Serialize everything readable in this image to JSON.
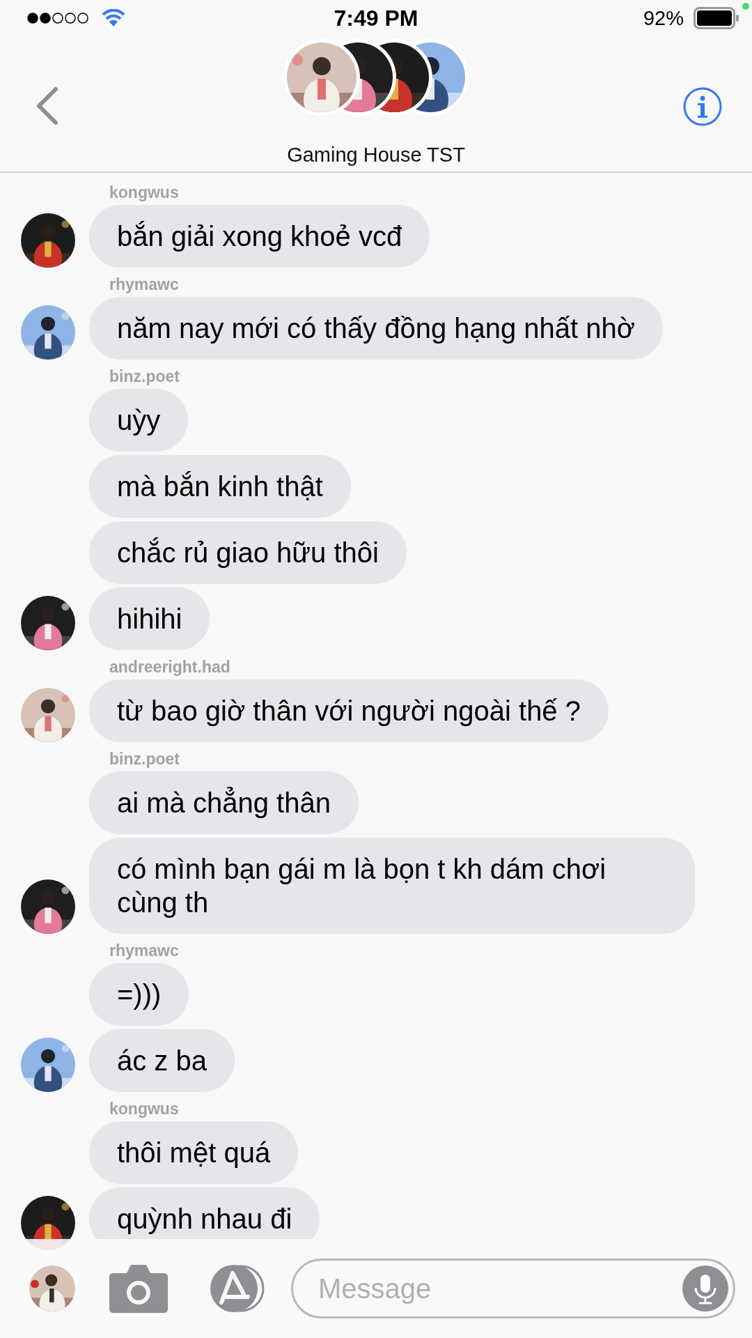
{
  "status_bar": {
    "time": "7:49 PM",
    "battery": "92%"
  },
  "conversation": {
    "title": "Gaming House TST"
  },
  "groups": [
    {
      "sender": "kongwus",
      "messages": [
        {
          "text": "bắn giải xong khoẻ vcđ",
          "avatar": true
        }
      ]
    },
    {
      "sender": "rhymawc",
      "messages": [
        {
          "text": "năm nay mới có thấy đồng hạng nhất nhờ",
          "avatar": true
        }
      ]
    },
    {
      "sender": "binz.poet",
      "messages": [
        {
          "text": "uỳy",
          "avatar": false
        },
        {
          "text": "mà bắn kinh thật",
          "avatar": false
        },
        {
          "text": "chắc rủ giao hữu thôi",
          "avatar": false
        },
        {
          "text": "hihihi",
          "avatar": true
        }
      ]
    },
    {
      "sender": "andreeright.had",
      "messages": [
        {
          "text": "từ bao giờ thân với người ngoài thế ?",
          "avatar": true
        }
      ]
    },
    {
      "sender": "binz.poet",
      "messages": [
        {
          "text": "ai mà chẳng thân",
          "avatar": false
        },
        {
          "text": "có mình bạn gái m là bọn t kh dám chơi cùng th",
          "avatar": true
        }
      ]
    },
    {
      "sender": "rhymawc",
      "messages": [
        {
          "text": "=)))",
          "avatar": false
        },
        {
          "text": "ác z ba",
          "avatar": true
        }
      ]
    },
    {
      "sender": "kongwus",
      "messages": [
        {
          "text": "thôi mệt quá",
          "avatar": false
        },
        {
          "text": "quỳnh nhau đi",
          "avatar": true
        }
      ]
    }
  ],
  "composer": {
    "placeholder": "Message"
  }
}
